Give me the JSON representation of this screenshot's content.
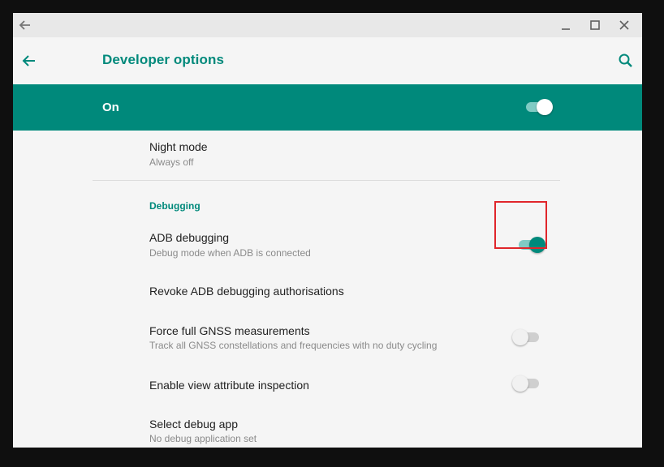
{
  "app": {
    "title": "Developer options"
  },
  "master": {
    "label": "On",
    "enabled": true
  },
  "colors": {
    "accent": "#00897b",
    "highlight_box": "#e0262b"
  },
  "rows": {
    "night_mode": {
      "title": "Night mode",
      "subtitle": "Always off"
    },
    "debugging_header": "Debugging",
    "adb_debugging": {
      "title": "ADB debugging",
      "subtitle": "Debug mode when ADB is connected",
      "enabled": true
    },
    "revoke_adb": {
      "title": "Revoke ADB debugging authorisations"
    },
    "gnss": {
      "title": "Force full GNSS measurements",
      "subtitle": "Track all GNSS constellations and frequencies with no duty cycling",
      "enabled": false
    },
    "view_attr": {
      "title": "Enable view attribute inspection",
      "enabled": false
    },
    "debug_app": {
      "title": "Select debug app",
      "subtitle": "No debug application set"
    }
  },
  "icons": {
    "titlebar_back": "arrow-left-icon",
    "minimize": "minimize-icon",
    "maximize": "maximize-icon",
    "close": "close-icon",
    "appbar_back": "arrow-left-icon",
    "search": "search-icon"
  }
}
